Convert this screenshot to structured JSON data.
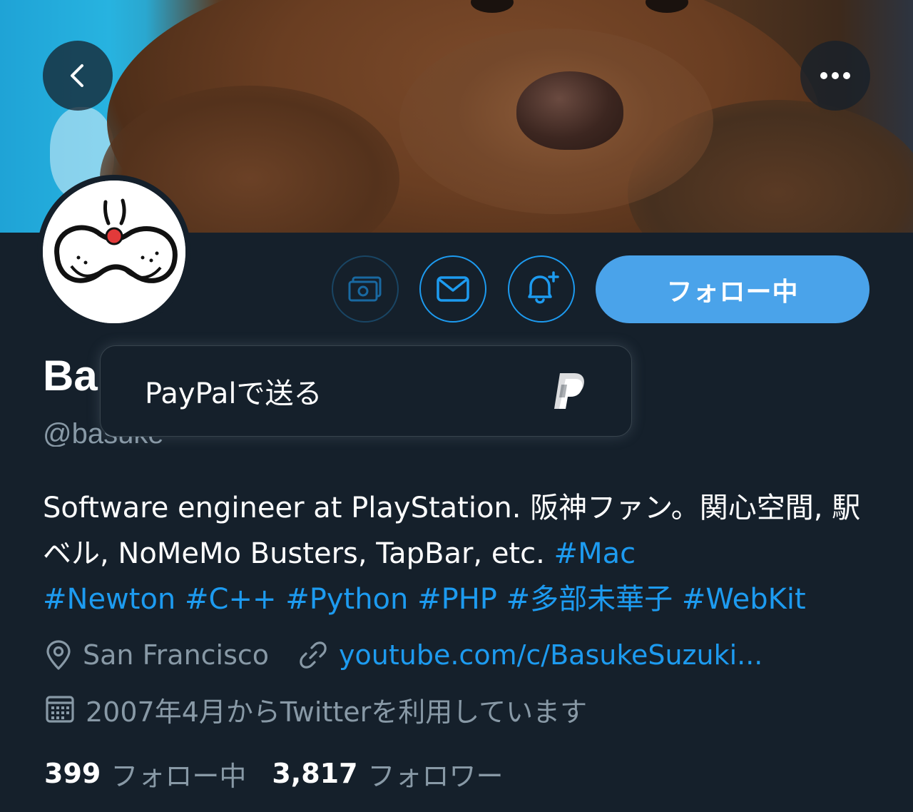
{
  "header": {
    "back_icon": "chevron-left-icon",
    "more_icon": "more-horizontal-icon"
  },
  "profile": {
    "name_partial": "Ba",
    "handle_partial": "@basuke",
    "bio_text": "Software engineer at PlayStation. 阪神ファン。関心空間, 駅ベル, NoMeMo Busters, TapBar, etc. ",
    "hashtags": [
      "#Mac",
      "#Newton",
      "#C++",
      "#Python",
      "#PHP",
      "#多部未華子",
      "#WebKit"
    ],
    "location": "San Francisco",
    "website": "youtube.com/c/BasukeSuzuki...",
    "joined": "2007年4月からTwitterを利用しています"
  },
  "actions": {
    "tip_icon": "money-icon",
    "message_icon": "envelope-icon",
    "notify_icon": "bell-plus-icon",
    "follow_label": "フォロー中"
  },
  "popover": {
    "label": "PayPalで送る",
    "icon": "paypal-icon"
  },
  "stats": {
    "following_count": "399",
    "following_label": "フォロー中",
    "followers_count": "3,817",
    "followers_label": "フォロワー"
  },
  "colors": {
    "background": "#15202b",
    "accent": "#1d9bf0",
    "follow_button": "#4aa3ea",
    "secondary_text": "#8899a6"
  }
}
